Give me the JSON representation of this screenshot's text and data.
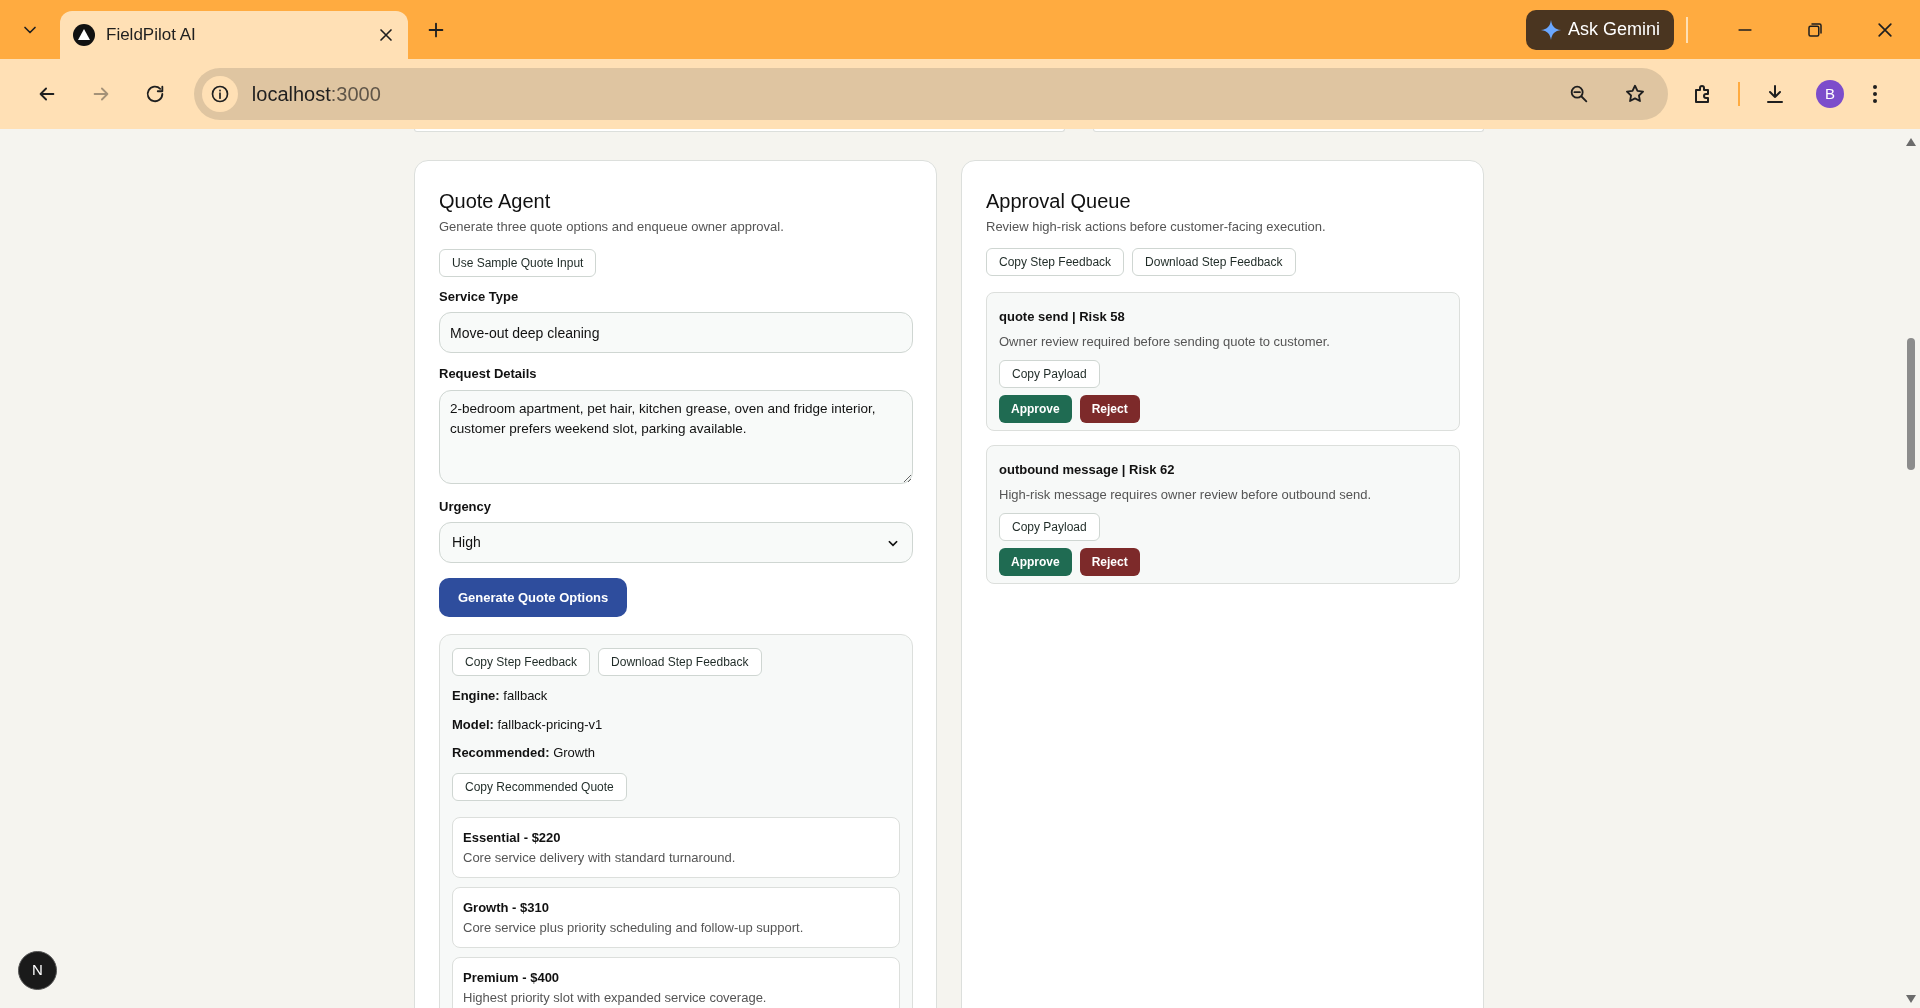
{
  "browser": {
    "tab_title": "FieldPilot AI",
    "url_host": "localhost",
    "url_port": ":3000",
    "gemini_label": "Ask Gemini",
    "avatar": "B"
  },
  "quote_agent": {
    "title": "Quote Agent",
    "subtitle": "Generate three quote options and enqueue owner approval.",
    "sample_button": "Use Sample Quote Input",
    "fields": [
      {
        "kind": "input",
        "label": "Service Type",
        "value": "Move-out deep cleaning"
      },
      {
        "kind": "textarea",
        "label": "Request Details",
        "value": "2-bedroom apartment, pet hair, kitchen grease, oven and fridge interior, customer prefers weekend slot, parking available."
      },
      {
        "kind": "select",
        "label": "Urgency",
        "value": "High"
      }
    ],
    "generate_button": "Generate Quote Options",
    "result": {
      "buttons": [
        "Copy Step Feedback",
        "Download Step Feedback"
      ],
      "facts": [
        {
          "label": "Engine:",
          "value": "fallback"
        },
        {
          "label": "Model:",
          "value": "fallback-pricing-v1"
        },
        {
          "label": "Recommended:",
          "value": "Growth"
        }
      ],
      "copy_button": "Copy Recommended Quote",
      "options": [
        {
          "title": "Essential - $220",
          "description": "Core service delivery with standard turnaround."
        },
        {
          "title": "Growth - $310",
          "description": "Core service plus priority scheduling and follow-up support."
        },
        {
          "title": "Premium - $400",
          "description": "Highest priority slot with expanded service coverage."
        }
      ]
    }
  },
  "approval_queue": {
    "title": "Approval Queue",
    "subtitle": "Review high-risk actions before customer-facing execution.",
    "buttons": [
      "Copy Step Feedback",
      "Download Step Feedback"
    ],
    "items": [
      {
        "title": "quote send | Risk 58",
        "description": "Owner review required before sending quote to customer.",
        "copy_button": "Copy Payload",
        "approve": "Approve",
        "reject": "Reject"
      },
      {
        "title": "outbound message | Risk 62",
        "description": "High-risk message requires owner review before outbound send.",
        "copy_button": "Copy Payload",
        "approve": "Approve",
        "reject": "Reject"
      }
    ]
  },
  "dev_badge": "N"
}
